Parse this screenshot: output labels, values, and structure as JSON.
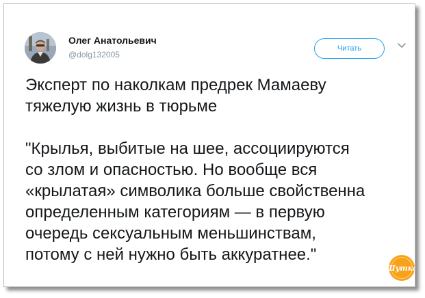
{
  "author": {
    "name": "Олег Анатольевич",
    "handle": "@dolg132005"
  },
  "follow_label": "Читать",
  "icons": {
    "avatar": "avatar-photo",
    "menu": "chevron-down-icon",
    "watermark": "site-logo"
  },
  "tweet": {
    "headline": "Эксперт по наколкам предрек Мамаеву\nтяжелую жизнь в тюрьме",
    "quote": "\"Крылья, выбитые на шее, ассоциируются\nсо злом и опасностью. Но вообще вся\n«крылатая» символика больше свойственна\nопределенным категориям — в первую\nочередь сексуальным меньшинствам,\nпотому с ней нужно быть аккуратнее.\""
  },
  "watermark_text": "Шутка",
  "colors": {
    "accent": "#1da1f2",
    "text": "#14171a",
    "muted": "#8899a6",
    "watermark": "#f7a21b"
  }
}
